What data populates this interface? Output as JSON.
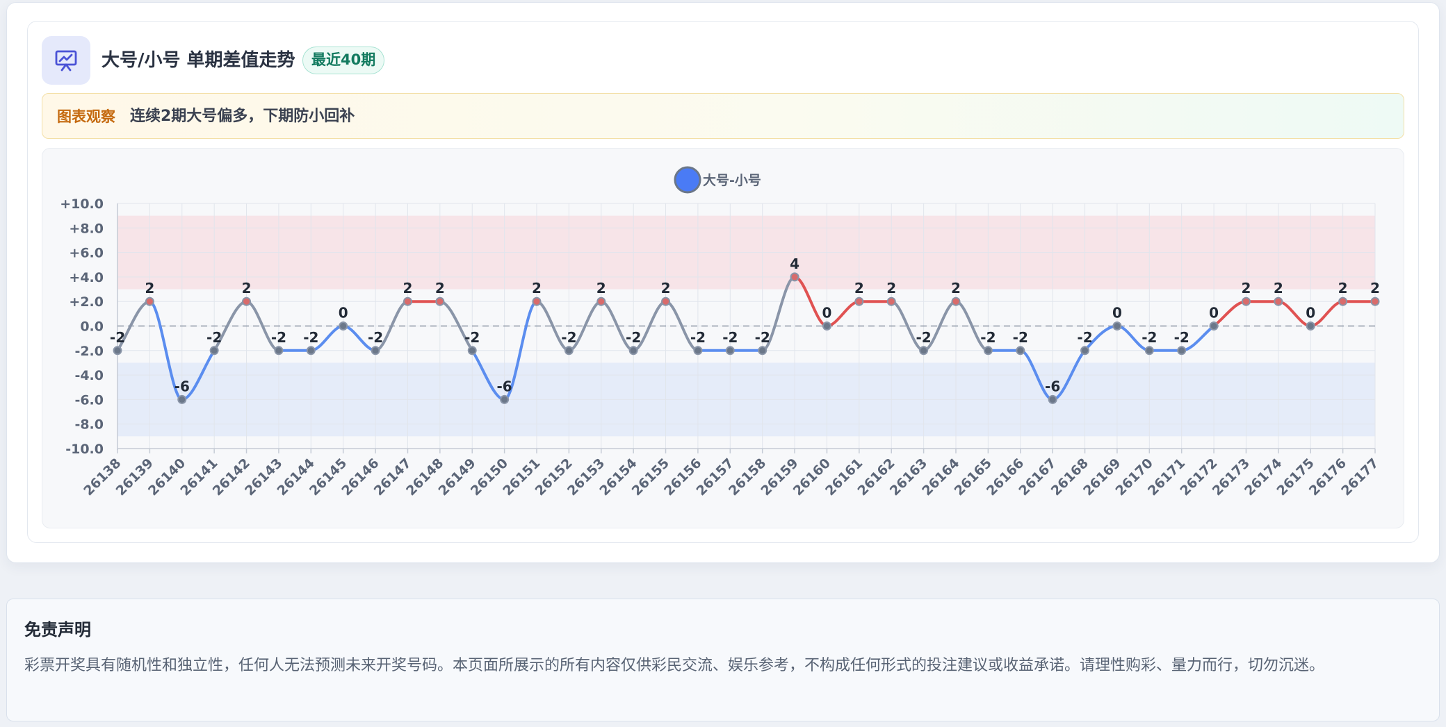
{
  "header": {
    "title": "大号/小号 单期差值走势",
    "badge": "最近40期",
    "icon": "chart-presentation-icon"
  },
  "insight": {
    "label": "图表观察",
    "text": "连续2期大号偏多，下期防小回补"
  },
  "chart_data": {
    "type": "line",
    "series": [
      {
        "name": "大号-小号",
        "values": [
          -2,
          2,
          -6,
          -2,
          2,
          -2,
          -2,
          0,
          -2,
          2,
          2,
          -2,
          -6,
          2,
          -2,
          2,
          -2,
          2,
          -2,
          -2,
          -2,
          4,
          0,
          2,
          2,
          -2,
          2,
          -2,
          -2,
          -6,
          -2,
          0,
          -2,
          -2,
          0,
          2,
          2,
          0,
          2,
          2
        ]
      }
    ],
    "categories": [
      "26138",
      "26139",
      "26140",
      "26141",
      "26142",
      "26143",
      "26144",
      "26145",
      "26146",
      "26147",
      "26148",
      "26149",
      "26150",
      "26151",
      "26152",
      "26153",
      "26154",
      "26155",
      "26156",
      "26157",
      "26158",
      "26159",
      "26160",
      "26161",
      "26162",
      "26163",
      "26164",
      "26165",
      "26166",
      "26167",
      "26168",
      "26169",
      "26170",
      "26171",
      "26172",
      "26173",
      "26174",
      "26175",
      "26176",
      "26177"
    ],
    "ylim": [
      -10,
      10
    ],
    "yticks": [
      10,
      8,
      6,
      4,
      2,
      0,
      -2,
      -4,
      -6,
      -8,
      -10
    ],
    "ytick_labels": [
      "+10.0",
      "+8.0",
      "+6.0",
      "+4.0",
      "+2.0",
      "0.0",
      "-2.0",
      "-4.0",
      "-6.0",
      "-8.0",
      "-10.0"
    ],
    "bands": [
      {
        "from": 3,
        "to": 9,
        "color": "#f7e4e8"
      },
      {
        "from": -9,
        "to": -3,
        "color": "#e5ecf9"
      }
    ],
    "zero_line": true,
    "grid": true,
    "legend": "top-center",
    "data_labels": true,
    "colors": {
      "positive": "#e05252",
      "negative": "#5b8def",
      "neutral": "#8a95a8",
      "legend_dot": "#4a7bf5",
      "point": "#6b7789"
    }
  },
  "disclaimer": {
    "title": "免责声明",
    "text": "彩票开奖具有随机性和独立性，任何人无法预测未来开奖号码。本页面所展示的所有内容仅供彩民交流、娱乐参考，不构成任何形式的投注建议或收益承诺。请理性购彩、量力而行，切勿沉迷。"
  }
}
